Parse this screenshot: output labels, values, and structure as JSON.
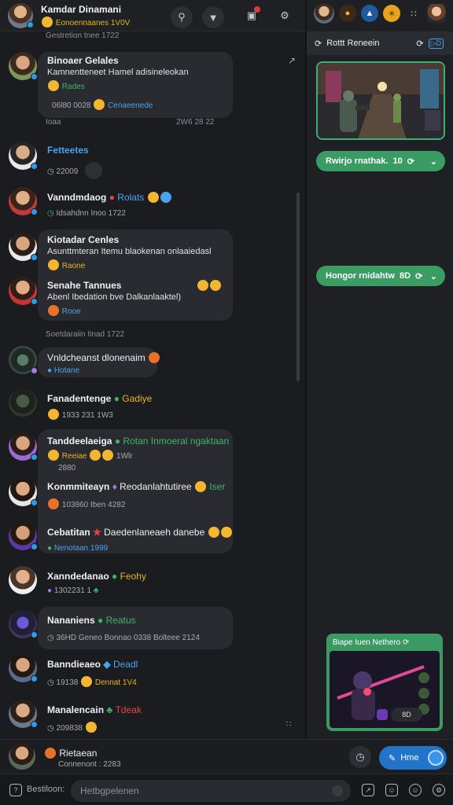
{
  "header": {
    "user_name": "Kamdar Dinamani",
    "user_status": "Eonoennaanes 1V0V",
    "icons": [
      "search-icon",
      "filter-icon",
      "notifications-icon",
      "settings-icon"
    ]
  },
  "right_panel": {
    "top_icons": [
      "avatar",
      "emoji-icon",
      "box-icon",
      "sun-icon",
      "grid-icon",
      "avatar"
    ],
    "header_label": "Rottt Reneein",
    "pill1": "Rwirjo rnathak.",
    "pill1_meta": "10",
    "pill2": "Hongor rnidahtw",
    "pill2_meta": "8D",
    "card_title": "Biape Iuen Nethero",
    "card_badge": "8D"
  },
  "chat": {
    "top_timestamp": "Gestretion tnee 1722",
    "rows": [
      {
        "name": "Binoaer Gelales",
        "text": "Kamnentteneet Hamel adisineleokan",
        "tag": "Rades",
        "meta": "06l80 0028",
        "extra": "Cenaeenede",
        "foot": "Ioaa",
        "foot_right": "2W6 28 22"
      },
      {
        "name": "Fetteetes",
        "text": "22009"
      },
      {
        "name": "Vanndmdaog",
        "tag": "Rolats",
        "text": "Idsahdnn Inoo 1722"
      },
      {
        "name": "Kiotadar Cenles",
        "text": "Asunttmteran Itemu blaokenan onlaaiedasl",
        "tag": "Raone"
      },
      {
        "name": "Senahe Tannues",
        "text": "Abenl Ibedation bve Dalkanlaaktel)",
        "tag": "Rooe",
        "foot": "Soetdaraiin Iinad 1722"
      },
      {
        "name": "Vnldcheanst dlonenaim",
        "tag": "Hotane"
      },
      {
        "name": "Fanadentenge",
        "tag": "Gadiye",
        "text": "1933 231 1W3"
      },
      {
        "name": "Tanddeelaeiga",
        "tag": "Rotan Inmoeral ngaktaan",
        "text": "Reeiae",
        "extra": "1Wlr",
        "foot": "2880"
      },
      {
        "name": "Konmmiteayn",
        "tag": "Reodanlahtutiree",
        "extra": "Iser",
        "text": "103860 Iben 4282"
      },
      {
        "name": "Cebatitan",
        "tag": "Daedenlaneaeh danebe",
        "text": "Nenotaan 1999"
      },
      {
        "name": "Xanndedanao",
        "tag": "Feohy",
        "text": "1302231 1"
      },
      {
        "name": "Nananiens",
        "tag": "Reatus",
        "text": "36HD Geneo Bonnao 0338 Bolteee 2124"
      },
      {
        "name": "Banndieaeo",
        "tag": "Deadl",
        "text": "19138",
        "extra": "Dennat 1V4"
      },
      {
        "name": "Manalencain",
        "tag": "Tdeak",
        "text": "209838"
      }
    ]
  },
  "composer": {
    "name": "Rietaean",
    "sub": "Connenont : 2283",
    "send_label": "Hme"
  },
  "footer": {
    "label": "Bestiloon:",
    "search_placeholder": "Hetbgpelenen"
  }
}
